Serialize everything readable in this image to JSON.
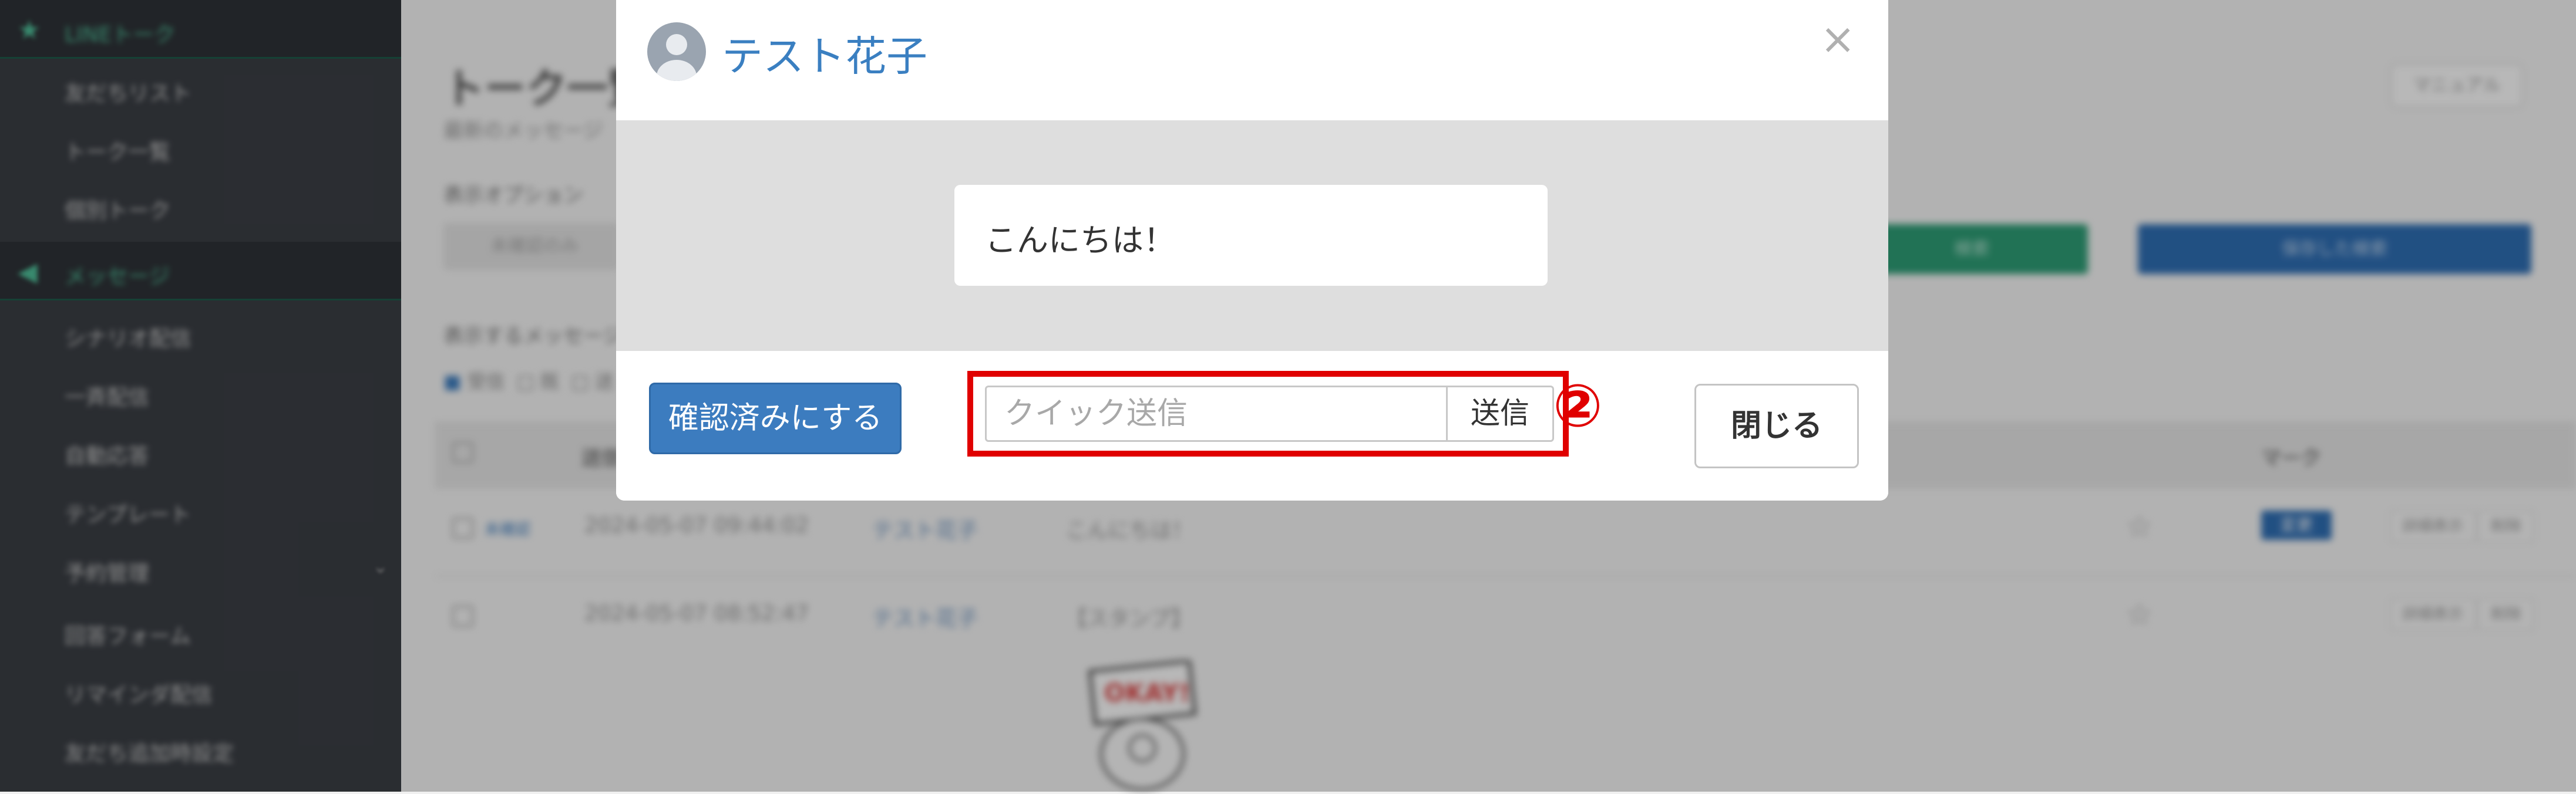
{
  "sidebar": {
    "items": [
      {
        "label": "LINEトーク",
        "type": "head",
        "icon": "star-icon"
      },
      {
        "label": "友だちリスト",
        "type": "sub"
      },
      {
        "label": "トーク一覧",
        "type": "sub"
      },
      {
        "label": "個別トーク",
        "type": "sub"
      },
      {
        "label": "メッセージ",
        "type": "head",
        "icon": "megaphone-icon"
      },
      {
        "label": "シナリオ配信",
        "type": "sub"
      },
      {
        "label": "一斉配信",
        "type": "sub"
      },
      {
        "label": "自動応答",
        "type": "sub"
      },
      {
        "label": "テンプレート",
        "type": "sub"
      },
      {
        "label": "予約管理",
        "type": "sub",
        "has_chevron": true
      },
      {
        "label": "回答フォーム",
        "type": "sub"
      },
      {
        "label": "リマインダ配信",
        "type": "sub"
      },
      {
        "label": "友だち追加時設定",
        "type": "sub"
      }
    ]
  },
  "page": {
    "title": "トーク一覧",
    "subtitle": "最新のメッセージ",
    "manual_label": "マニュアル",
    "display_options_label": "表示オプション",
    "option_select_text": "未確認のみ",
    "search_button_label": "検索",
    "saved_search_label": "保存した検索",
    "messages_to_show_label": "表示するメッセージ",
    "show_check_labels": [
      "受信",
      "既",
      "送"
    ]
  },
  "table": {
    "headers": {
      "sent": "送信日時",
      "mark": "マーク"
    },
    "rows": [
      {
        "status": "未確認",
        "datetime": "2024-05-07 09:44:02",
        "name": "テスト花子",
        "message": "こんにちは！",
        "mark": "変更",
        "detail": "詳細表示",
        "delete": "削除"
      },
      {
        "status": "",
        "datetime": "2024-05-07 08:52:47",
        "name": "テスト花子",
        "message": "【スタンプ】",
        "mark": "",
        "detail": "詳細表示",
        "delete": "削除"
      }
    ],
    "sticker_text": "OKAY!"
  },
  "modal": {
    "title": "テスト花子",
    "close_symbol": "×",
    "message_text": "こんにちは！",
    "confirm_button_label": "確認済みにする",
    "quick_send_placeholder": "クイック送信",
    "quick_send_value": "",
    "send_button_label": "送信",
    "close_button_label": "閉じる",
    "annotation_number": "②",
    "annotation_color": "#e00000"
  },
  "colors": {
    "accent_blue": "#3c7cbf",
    "title_blue": "#3a7fc1",
    "sidebar_bg": "#3b3f45",
    "sidebar_accent": "#4fbf99"
  }
}
